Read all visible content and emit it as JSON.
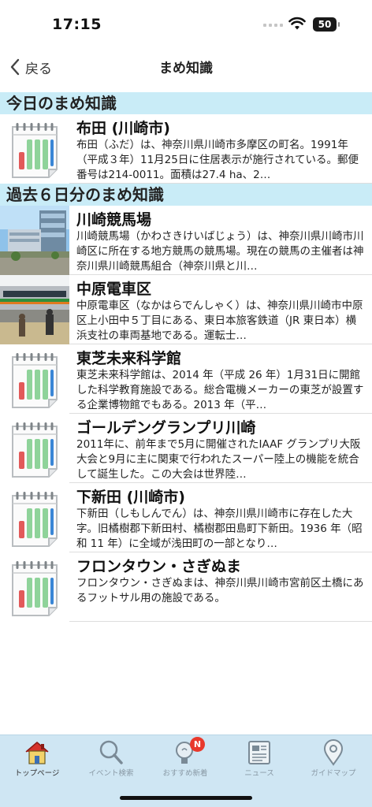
{
  "status": {
    "time": "17:15",
    "battery": "50"
  },
  "nav": {
    "back_label": "戻る",
    "title": "まめ知識"
  },
  "sections": {
    "today": "今日のまめ知識",
    "past": "過去６日分のまめ知識"
  },
  "today_item": {
    "title": "布田 (川崎市)",
    "desc": "布田（ふだ）は、神奈川県川崎市多摩区の町名。1991年（平成３年）11月25日に住居表示が施行されている。郵便番号は214-0011。面積は27.4 ha、2…",
    "thumb": "calendar-icon"
  },
  "past_items": [
    {
      "title": "川崎競馬場",
      "desc": "川崎競馬場（かわさきけいばじょう）は、神奈川県川崎市川崎区に所在する地方競馬の競馬場。現在の競馬の主催者は神奈川県川崎競馬組合（神奈川県と川…",
      "thumb": "racecourse-photo"
    },
    {
      "title": "中原電車区",
      "desc": "中原電車区（なかはらでんしゃく）は、神奈川県川崎市中原区上小田中５丁目にある、東日本旅客鉄道（JR 東日本）横浜支社の車両基地である。運転士…",
      "thumb": "train-depot-photo"
    },
    {
      "title": "東芝未来科学館",
      "desc": "東芝未来科学館は、2014 年（平成 26 年）1月31日に開館した科学教育施設である。総合電機メーカーの東芝が設置する企業博物館でもある。2013 年（平…",
      "thumb": "calendar-icon"
    },
    {
      "title": "ゴールデングランプリ川崎",
      "desc": "2011年に、前年まで5月に開催されたIAAF グランプリ大阪大会と9月に主に関東で行われたスーパー陸上の機能を統合して誕生した。この大会は世界陸…",
      "thumb": "calendar-icon"
    },
    {
      "title": "下新田 (川崎市)",
      "desc": "下新田（しもしんでん）は、神奈川県川崎市に存在した大字。旧橘樹郡下新田村、橘樹郡田島町下新田。1936 年（昭和 11 年）に全域が浅田町の一部となり…",
      "thumb": "calendar-icon"
    },
    {
      "title": "フロンタウン・さぎぬま",
      "desc": "フロンタウン・さぎぬまは、神奈川県川崎市宮前区土橋にあるフットサル用の施設である。",
      "thumb": "calendar-icon"
    }
  ],
  "tabs": [
    {
      "label": "トップページ",
      "icon": "home-icon"
    },
    {
      "label": "イベント検索",
      "icon": "search-icon"
    },
    {
      "label": "おすすめ新着",
      "icon": "lightbulb-icon",
      "badge": "N"
    },
    {
      "label": "ニュース",
      "icon": "newspaper-icon"
    },
    {
      "label": "ガイドマップ",
      "icon": "map-pin-icon"
    }
  ],
  "colors": {
    "section_bg": "#c9ecf7",
    "tab_bg": "#cfe6f3",
    "badge": "#e8392c"
  }
}
